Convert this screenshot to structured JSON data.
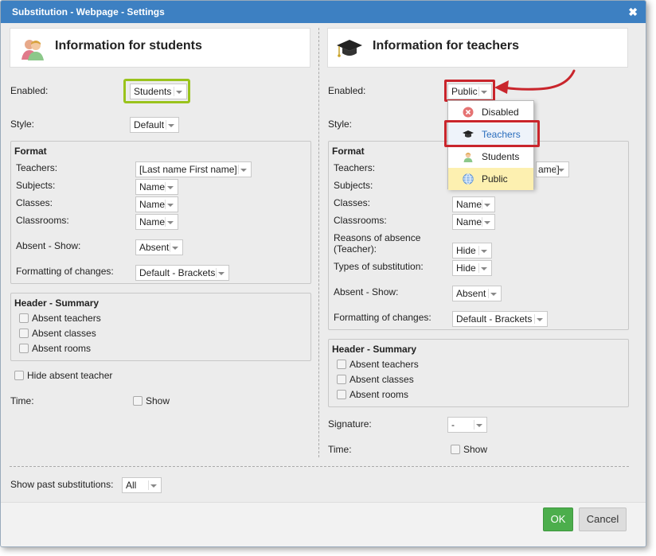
{
  "window": {
    "title": "Substitution - Webpage - Settings",
    "close": "✖"
  },
  "students": {
    "heading": "Information for students",
    "enabled_label": "Enabled:",
    "enabled_value": "Students",
    "style_label": "Style:",
    "style_value": "Default",
    "format_title": "Format",
    "teachers_label": "Teachers:",
    "teachers_value": "[Last name First name]",
    "subjects_label": "Subjects:",
    "subjects_value": "Name",
    "classes_label": "Classes:",
    "classes_value": "Name",
    "classrooms_label": "Classrooms:",
    "classrooms_value": "Name",
    "absent_label": "Absent - Show:",
    "absent_value": "Absent",
    "formatting_label": "Formatting of changes:",
    "formatting_value": "Default - Brackets",
    "header_title": "Header - Summary",
    "absent_teachers": "Absent teachers",
    "absent_classes": "Absent classes",
    "absent_rooms": "Absent rooms",
    "hide_absent_teacher": "Hide absent teacher",
    "time_label": "Time:",
    "time_show": "Show"
  },
  "teachers": {
    "heading": "Information for teachers",
    "enabled_label": "Enabled:",
    "enabled_value": "Public",
    "style_label": "Style:",
    "format_title": "Format",
    "teachers_label": "Teachers:",
    "teachers_value_tail": "ame]",
    "subjects_label": "Subjects:",
    "classes_label": "Classes:",
    "classes_value": "Name",
    "classrooms_label": "Classrooms:",
    "classrooms_value": "Name",
    "reasons_label_1": "Reasons of absence",
    "reasons_label_2": "(Teacher):",
    "reasons_value": "Hide",
    "types_label": "Types of substitution:",
    "types_value": "Hide",
    "absent_label": "Absent - Show:",
    "absent_value": "Absent",
    "formatting_label": "Formatting of changes:",
    "formatting_value": "Default - Brackets",
    "header_title": "Header - Summary",
    "absent_teachers": "Absent teachers",
    "absent_classes": "Absent classes",
    "absent_rooms": "Absent rooms",
    "signature_label": "Signature:",
    "signature_value": "-",
    "time_label": "Time:",
    "time_show": "Show"
  },
  "dropdown": {
    "items": [
      {
        "label": "Disabled",
        "icon": "disabled-icon"
      },
      {
        "label": "Teachers",
        "icon": "graduation-cap-icon"
      },
      {
        "label": "Students",
        "icon": "student-icon"
      },
      {
        "label": "Public",
        "icon": "globe-icon"
      }
    ],
    "highlight_color": "#fdf0b0",
    "selected_text_color": "#2a6ebd"
  },
  "footer": {
    "show_past_label": "Show past substitutions:",
    "show_past_value": "All",
    "ok": "OK",
    "cancel": "Cancel"
  },
  "colors": {
    "titlebar": "#3d80c2",
    "ok": "#4cae4c",
    "annotation_red": "#c9252c",
    "annotation_green": "#9ac31c"
  }
}
